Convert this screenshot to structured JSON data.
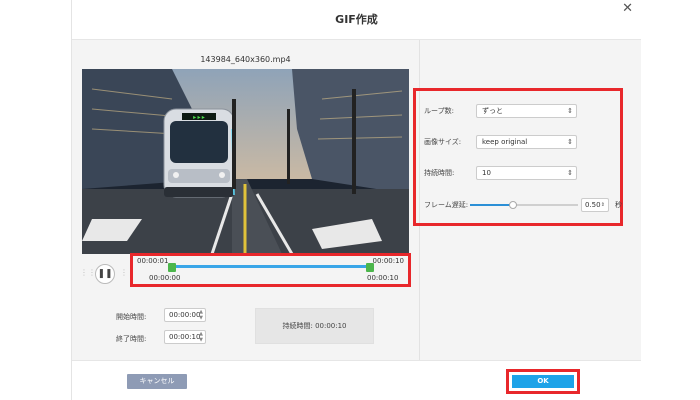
{
  "dialog": {
    "title": "GIF作成",
    "close_glyph": "✕"
  },
  "video": {
    "filename": "143984_640x360.mp4"
  },
  "playback": {
    "pause_glyph": "❚❚"
  },
  "timeline": {
    "start_time": "00:00:01",
    "end_time": "00:00:10",
    "handle_start_time": "00:00:00",
    "handle_end_time": "00:00:10"
  },
  "trim": {
    "start_label": "開始時間:",
    "start_value": "00:00:00",
    "end_label": "終了時間:",
    "end_value": "00:00:10",
    "duration_text": "持続時間: 00:00:10"
  },
  "settings": {
    "loop": {
      "label": "ループ数:",
      "value": "ずっと"
    },
    "size": {
      "label": "画像サイズ:",
      "value": "keep original"
    },
    "duration": {
      "label": "持続時間:",
      "value": "10"
    },
    "delay": {
      "label": "フレーム遅延:",
      "value": "0.50",
      "unit": "秒",
      "slider_fraction": 0.4
    }
  },
  "footer": {
    "cancel_label": "キャンセル",
    "ok_label": "OK"
  },
  "colors": {
    "accent": "#1ea3e8",
    "highlight": "#e8272b",
    "handle": "#4cb64c",
    "timeline": "#3aa6e8"
  }
}
